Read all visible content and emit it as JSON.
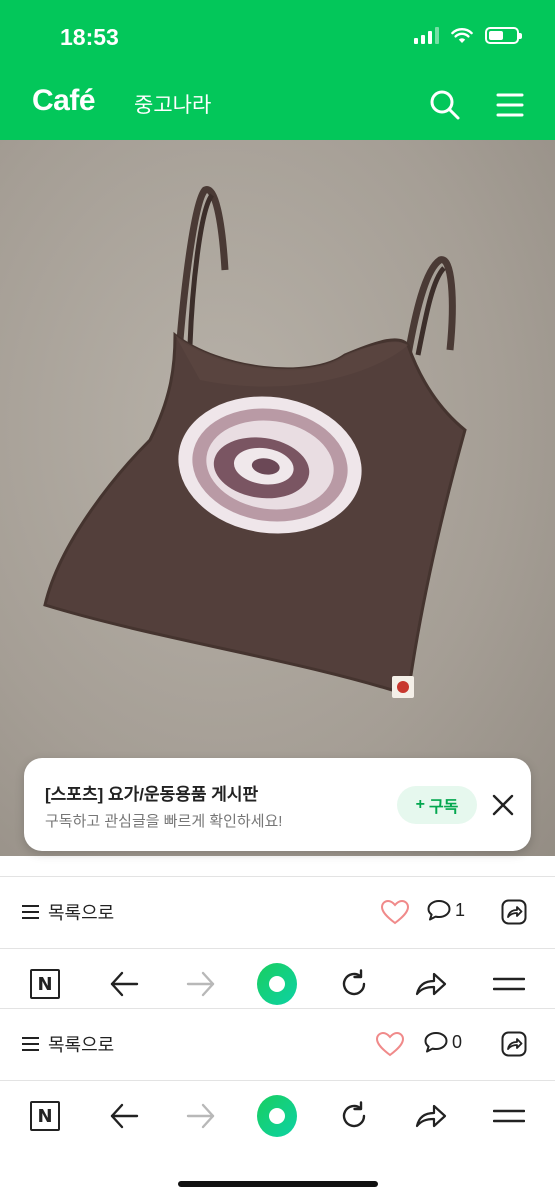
{
  "status_bar": {
    "time": "18:53"
  },
  "header": {
    "logo": "Café",
    "cafe_name": "중고나라"
  },
  "banner": {
    "title": "[스포츠] 요가/운동용품 게시판",
    "subtitle": "구독하고 관심글을 빠르게 확인하세요!",
    "subscribe_label": "구독",
    "subscribe_prefix": "+"
  },
  "post_bars": [
    {
      "list_label": "목록으로",
      "comment_count": "1"
    },
    {
      "list_label": "목록으로",
      "comment_count": "0"
    }
  ],
  "toolbar": {
    "n_label": "N"
  },
  "colors": {
    "brand_green": "#03c75a",
    "like_heart": "#f08a8a"
  }
}
